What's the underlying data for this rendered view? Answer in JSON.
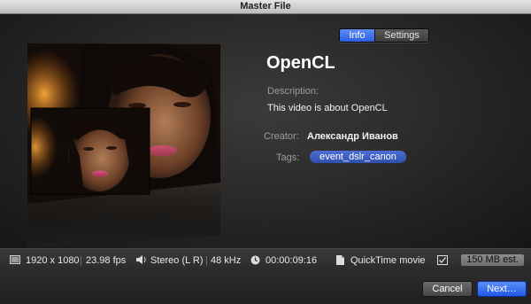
{
  "window": {
    "title": "Master File"
  },
  "tabs": [
    {
      "label": "Info",
      "active": true
    },
    {
      "label": "Settings",
      "active": false
    }
  ],
  "details": {
    "title": "OpenCL",
    "description_label": "Description:",
    "description_value": "This video is about OpenCL",
    "creator_label": "Creator:",
    "creator_value": "Александр Иванов",
    "tags_label": "Tags:",
    "tags": [
      "event_dslr_canon"
    ]
  },
  "infobar": {
    "resolution": "1920 x 1080",
    "fps": "23.98 fps",
    "audio": "Stereo (L R)",
    "sample_rate": "48 kHz",
    "duration": "00:00:09:16",
    "format": "QuickTime movie",
    "size_estimate": "150 MB est."
  },
  "footer": {
    "cancel_label": "Cancel",
    "next_label": "Next…"
  },
  "colors": {
    "accent": "#3d6be8",
    "tag_fill": "#3f5fc4",
    "background": "#1d1d1d"
  }
}
